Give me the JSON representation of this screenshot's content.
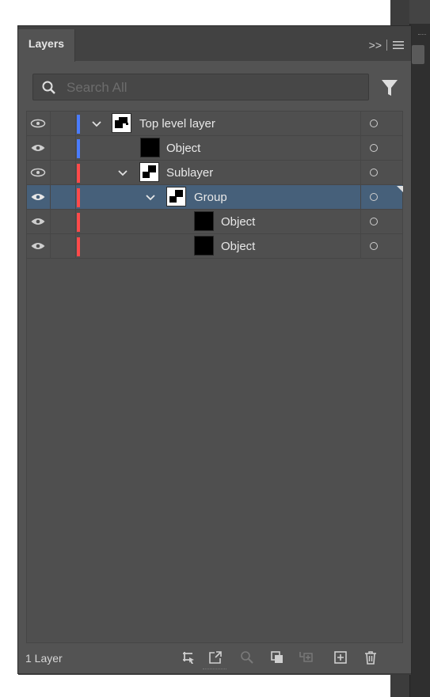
{
  "panel": {
    "tab_label": "Layers",
    "menu_icons": [
      "collapse-icon",
      "panel-menu-icon"
    ]
  },
  "search": {
    "placeholder": "Search All"
  },
  "rows": [
    {
      "name": "Top level layer",
      "color": "#4a7cff",
      "expanded": true,
      "selected": false
    },
    {
      "name": "Object",
      "color": "#4a7cff",
      "expanded": false,
      "selected": false
    },
    {
      "name": "Sublayer",
      "color": "#ff4a4a",
      "expanded": true,
      "selected": false
    },
    {
      "name": "Group",
      "color": "#ff4a4a",
      "expanded": true,
      "selected": true
    },
    {
      "name": "Object",
      "color": "#ff4a4a",
      "expanded": false,
      "selected": false
    },
    {
      "name": "Object",
      "color": "#ff4a4a",
      "expanded": false,
      "selected": false
    }
  ],
  "footer": {
    "layer_count": "1 Layer",
    "icons": [
      "collect-for-export-icon",
      "export-icon",
      "locate-object-icon",
      "make-clipping-mask-icon",
      "new-sublayer-icon",
      "new-layer-icon",
      "delete-icon"
    ]
  },
  "colors": {
    "panel_bg": "#535353",
    "selected_row": "#46607a",
    "blue_layer": "#4a7cff",
    "red_layer": "#ff4a4a"
  }
}
